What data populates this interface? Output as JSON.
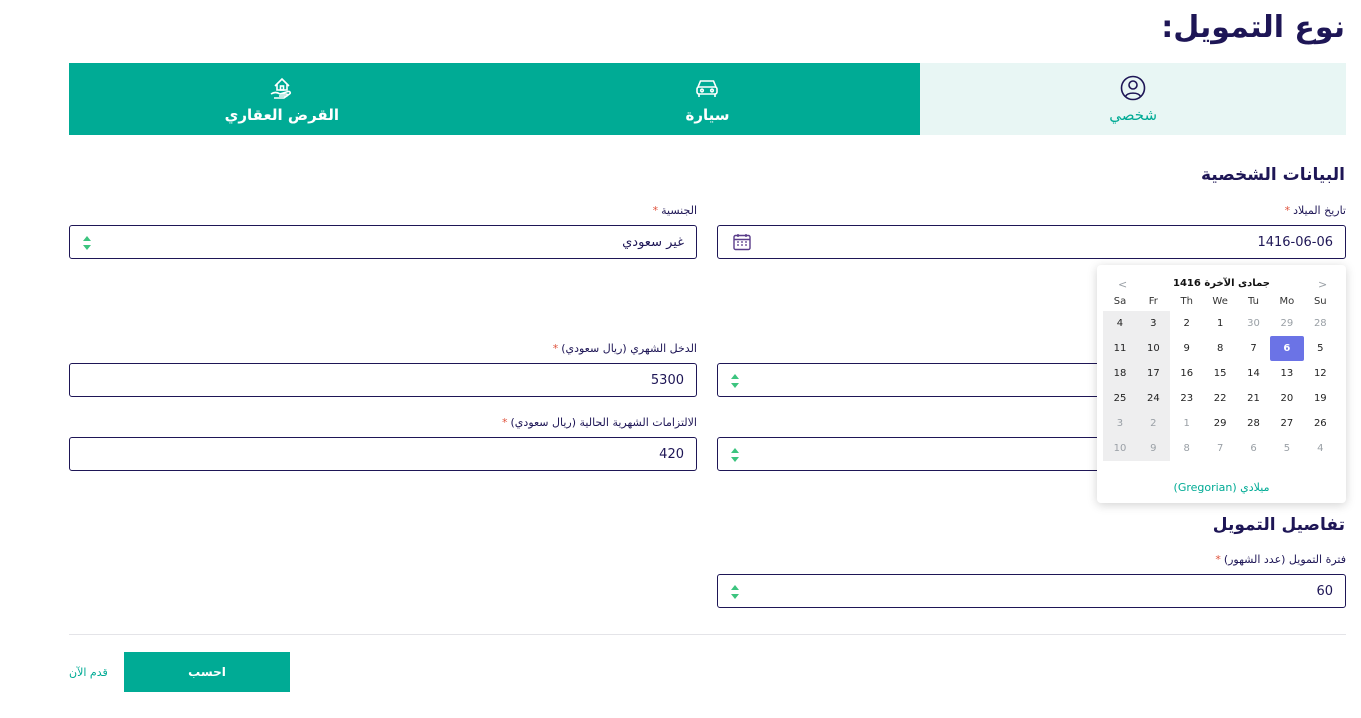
{
  "page": {
    "title": "نوع التمويل:"
  },
  "tabs": [
    {
      "label": "شخصي",
      "icon": "user-circle-icon",
      "active": true
    },
    {
      "label": "سيارة",
      "icon": "car-icon",
      "active": false
    },
    {
      "label": "القرض العقاري",
      "icon": "house-hand-icon",
      "active": false
    }
  ],
  "personal": {
    "title": "البيانات الشخصية",
    "birth_date": {
      "label": "تاريخ الميلاد",
      "value": "1416-06-06"
    },
    "nationality": {
      "label": "الجنسية",
      "value": "غير سعودي"
    },
    "income": {
      "label": "الدخل الشهري (ريال سعودي)",
      "value": "5300"
    },
    "obligations": {
      "label": "الالتزامات الشهرية الحالية (ريال سعودي)",
      "value": "420"
    }
  },
  "datepicker": {
    "month_label": "جمادى الآخرة 1416",
    "prev": "<",
    "next": ">",
    "weekdays": [
      "Su",
      "Mo",
      "Tu",
      "We",
      "Th",
      "Fr",
      "Sa"
    ],
    "weeks": [
      [
        "28",
        "29",
        "30",
        "1",
        "2",
        "3",
        "4"
      ],
      [
        "5",
        "6",
        "7",
        "8",
        "9",
        "10",
        "11"
      ],
      [
        "12",
        "13",
        "14",
        "15",
        "16",
        "17",
        "18"
      ],
      [
        "19",
        "20",
        "21",
        "22",
        "23",
        "24",
        "25"
      ],
      [
        "26",
        "27",
        "28",
        "29",
        "1",
        "2",
        "3"
      ],
      [
        "4",
        "5",
        "6",
        "7",
        "8",
        "9",
        "10"
      ]
    ],
    "footer": "ميلادي (Gregorian)"
  },
  "finance": {
    "title": "تفاصيل التمويل",
    "period": {
      "label": "فترة التمويل (عدد الشهور)",
      "value": "60"
    }
  },
  "actions": {
    "calculate": "احسب",
    "apply": "قدم الآن"
  },
  "colors": {
    "accent": "#00ab95",
    "navy": "#1e1656",
    "selected_day": "#6b73e6",
    "required": "#e0533d"
  }
}
